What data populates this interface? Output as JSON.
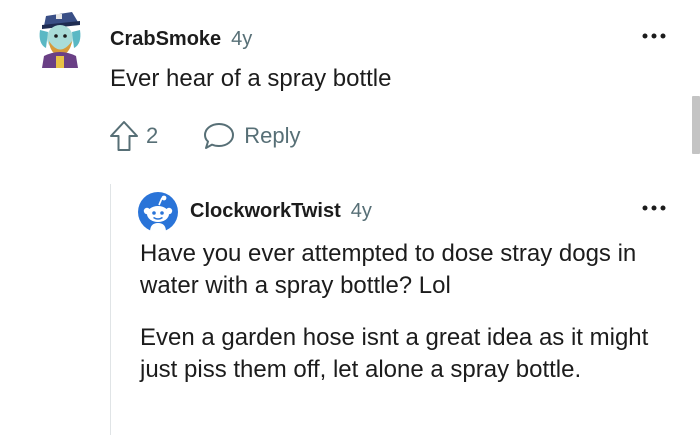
{
  "comment": {
    "author": "CrabSmoke",
    "age": "4y",
    "body": "Ever hear of a spray bottle",
    "vote_count": "2",
    "reply_label": "Reply",
    "more_icon": "more-options-icon"
  },
  "reply": {
    "author": "ClockworkTwist",
    "age": "4y",
    "paragraphs": [
      "Have you ever attempted to dose stray dogs in water with a spray bottle? Lol",
      "Even a garden hose isnt a great idea as it might just piss them off, let alone a spray bottle."
    ],
    "more_icon": "more-options-icon"
  },
  "colors": {
    "text": "#1c1c1c",
    "meta": "#576f76",
    "snoo_blue": "#2a74d8",
    "thread_line": "#e0e4e6"
  }
}
